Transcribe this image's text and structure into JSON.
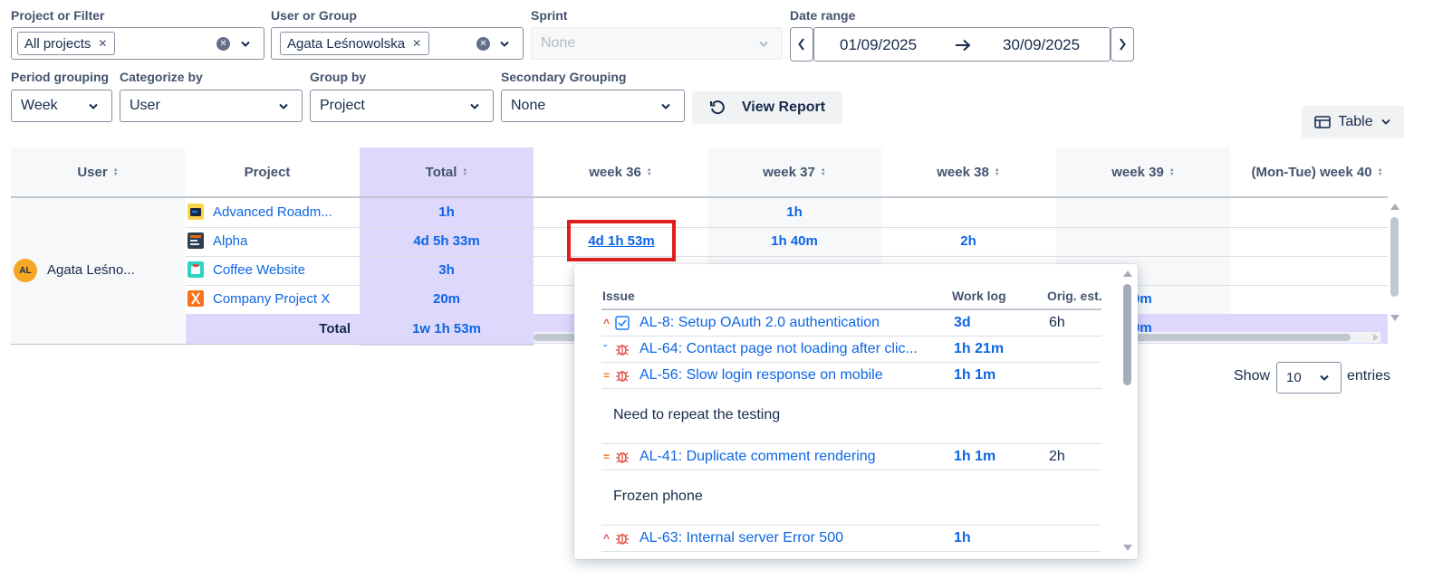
{
  "filters": {
    "project_label": "Project or Filter",
    "project_chip": "All projects",
    "user_label": "User or Group",
    "user_chip": "Agata Leśnowolska",
    "sprint_label": "Sprint",
    "sprint_placeholder": "None",
    "date_label": "Date range",
    "date_from": "01/09/2025",
    "date_to": "30/09/2025",
    "period_label": "Period grouping",
    "period_value": "Week",
    "categorize_label": "Categorize by",
    "categorize_value": "User",
    "groupby_label": "Group by",
    "groupby_value": "Project",
    "secondary_label": "Secondary Grouping",
    "secondary_value": "None",
    "view_report": "View Report",
    "view_mode": "Table"
  },
  "table": {
    "headers": [
      "User",
      "Project",
      "Total",
      "week 36",
      "week 37",
      "week 38",
      "week 39",
      "(Mon-Tue) week 40"
    ],
    "user_initials": "AL",
    "user_name": "Agata Leśno...",
    "rows": [
      {
        "project": "Advanced Roadm...",
        "icon_color": "#1d7afc",
        "total": "1h",
        "w36": "",
        "w37": "1h",
        "w38": "",
        "w39": "",
        "w40": ""
      },
      {
        "project": "Alpha",
        "icon_color": "#e56910",
        "total": "4d 5h 33m",
        "w36": "4d 1h 53m",
        "w37": "1h 40m",
        "w38": "2h",
        "w39": "",
        "w40": ""
      },
      {
        "project": "Coffee Website",
        "icon_color": "#22a06b",
        "total": "3h",
        "w36": "",
        "w37": "",
        "w38": "",
        "w39": "",
        "w40": ""
      },
      {
        "project": "Company Project X",
        "icon_color": "#e2483d",
        "total": "20m",
        "w36": "",
        "w37": "",
        "w38": "",
        "w39": "0m",
        "w40": ""
      }
    ],
    "total_label": "Total",
    "grand_total": "1w 1h 53m",
    "w39_partial_total": "0m"
  },
  "pagination": {
    "show_label": "Show",
    "page_size": "10",
    "entries_label": "entries"
  },
  "popover": {
    "col_issue": "Issue",
    "col_worklog": "Work log",
    "col_est": "Orig. est.",
    "items": [
      {
        "type": "task",
        "priority": "^",
        "title": "AL-8: Setup OAuth 2.0 authentication",
        "worklog": "3d",
        "est": "6h",
        "note": ""
      },
      {
        "type": "bug",
        "priority": "ˇ",
        "title": "AL-64: Contact page not loading after clic...",
        "worklog": "1h 21m",
        "est": "",
        "note": ""
      },
      {
        "type": "bug",
        "priority": "=",
        "title": "AL-56: Slow login response on mobile",
        "worklog": "1h 1m",
        "est": "",
        "note": "Need to repeat the testing"
      },
      {
        "type": "bug",
        "priority": "=",
        "title": "AL-41: Duplicate comment rendering",
        "worklog": "1h 1m",
        "est": "2h",
        "note": "Frozen phone"
      },
      {
        "type": "bug",
        "priority": "^",
        "title": "AL-63: Internal server Error 500",
        "worklog": "1h",
        "est": "",
        "note": ""
      }
    ]
  },
  "colors": {
    "accent": "#0c66e4",
    "total_col": "#dfd8fd",
    "highlight_border": "#e01e1e"
  }
}
